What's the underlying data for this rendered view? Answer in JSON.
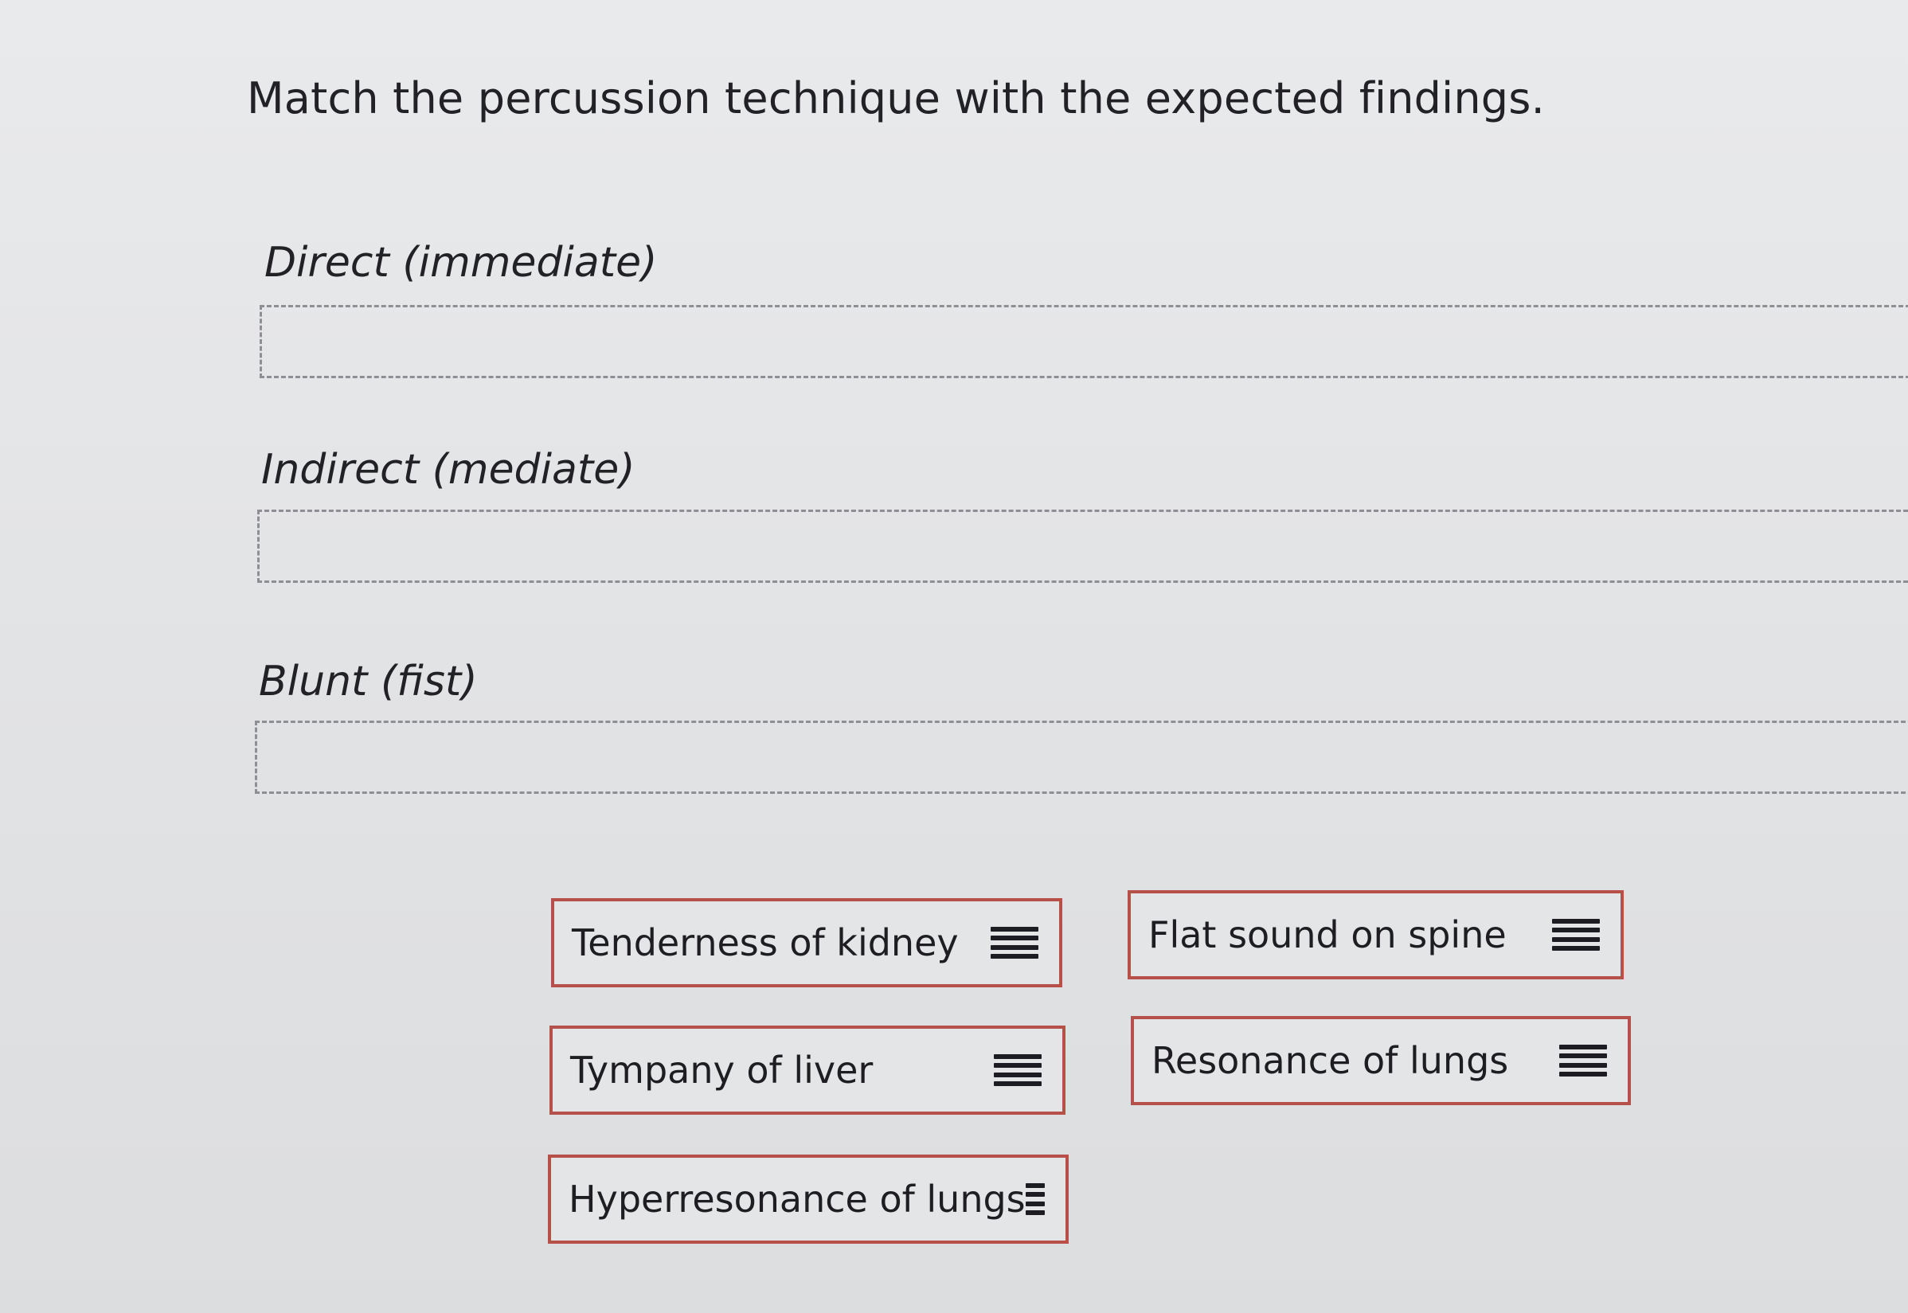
{
  "question": "Match the percussion technique with the expected findings.",
  "targets": [
    {
      "label": "Direct (immediate)"
    },
    {
      "label": "Indirect (mediate)"
    },
    {
      "label": "Blunt (fist)"
    }
  ],
  "options": [
    {
      "label": "Tenderness of kidney",
      "icon": "drag-handle-icon"
    },
    {
      "label": "Flat sound on spine",
      "icon": "drag-handle-icon"
    },
    {
      "label": "Tympany of liver",
      "icon": "drag-handle-icon"
    },
    {
      "label": "Resonance of lungs",
      "icon": "drag-handle-icon"
    },
    {
      "label": "Hyperresonance of lungs",
      "icon": "drag-handle-icon"
    }
  ],
  "colors": {
    "card_border": "#b8504a",
    "dropzone_border": "#8e8f94",
    "background": "#e1e2e4"
  }
}
